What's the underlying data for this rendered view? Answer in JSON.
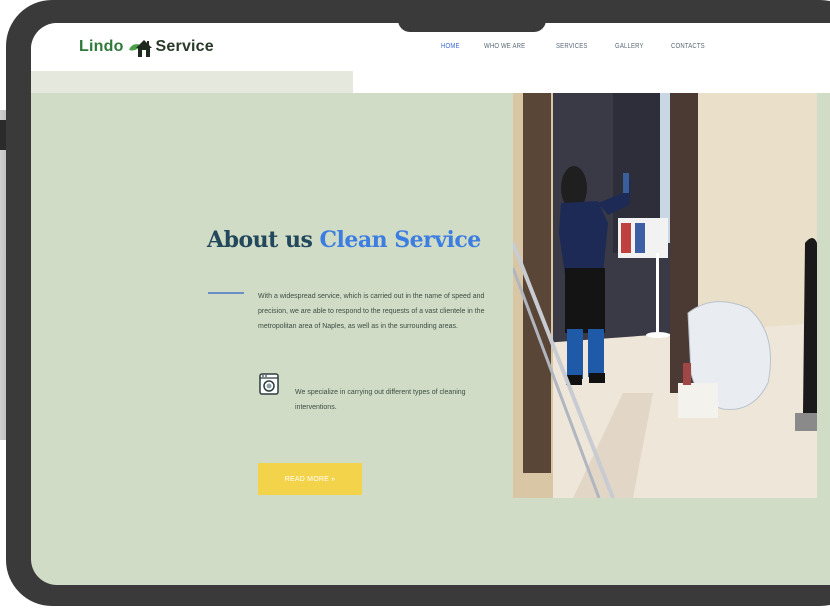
{
  "header": {
    "logo": {
      "word1": "Lindo",
      "word2": "Service",
      "icon": "house-leaf-logo"
    },
    "nav": [
      {
        "label": "HOME",
        "active": true
      },
      {
        "label": "WHO WE ARE",
        "active": false
      },
      {
        "label": "SERVICES",
        "active": false
      },
      {
        "label": "GALLERY",
        "active": false
      },
      {
        "label": "CONTACTS",
        "active": false
      }
    ]
  },
  "about": {
    "title_main": "About us ",
    "title_accent": "Clean Service",
    "paragraph": "With a widespread service, which is carried out in the name of speed and precision, we are able to respond to the requests of a vast clientele in the metropolitan area of Naples, as well as in the surrounding areas.",
    "specialty": {
      "icon": "washing-machine-icon",
      "text": "We specialize in carrying out different types of cleaning interventions."
    },
    "button": "READ MORE »"
  },
  "photo": {
    "subject": "cleaning-staff-photo"
  },
  "colors": {
    "content_bg": "#d0dcc5",
    "title": "#23485c",
    "accent": "#3c7de2",
    "button": "#f3d34a",
    "nav_active": "#3c6ad8",
    "device_frame": "#3a3a3a"
  }
}
